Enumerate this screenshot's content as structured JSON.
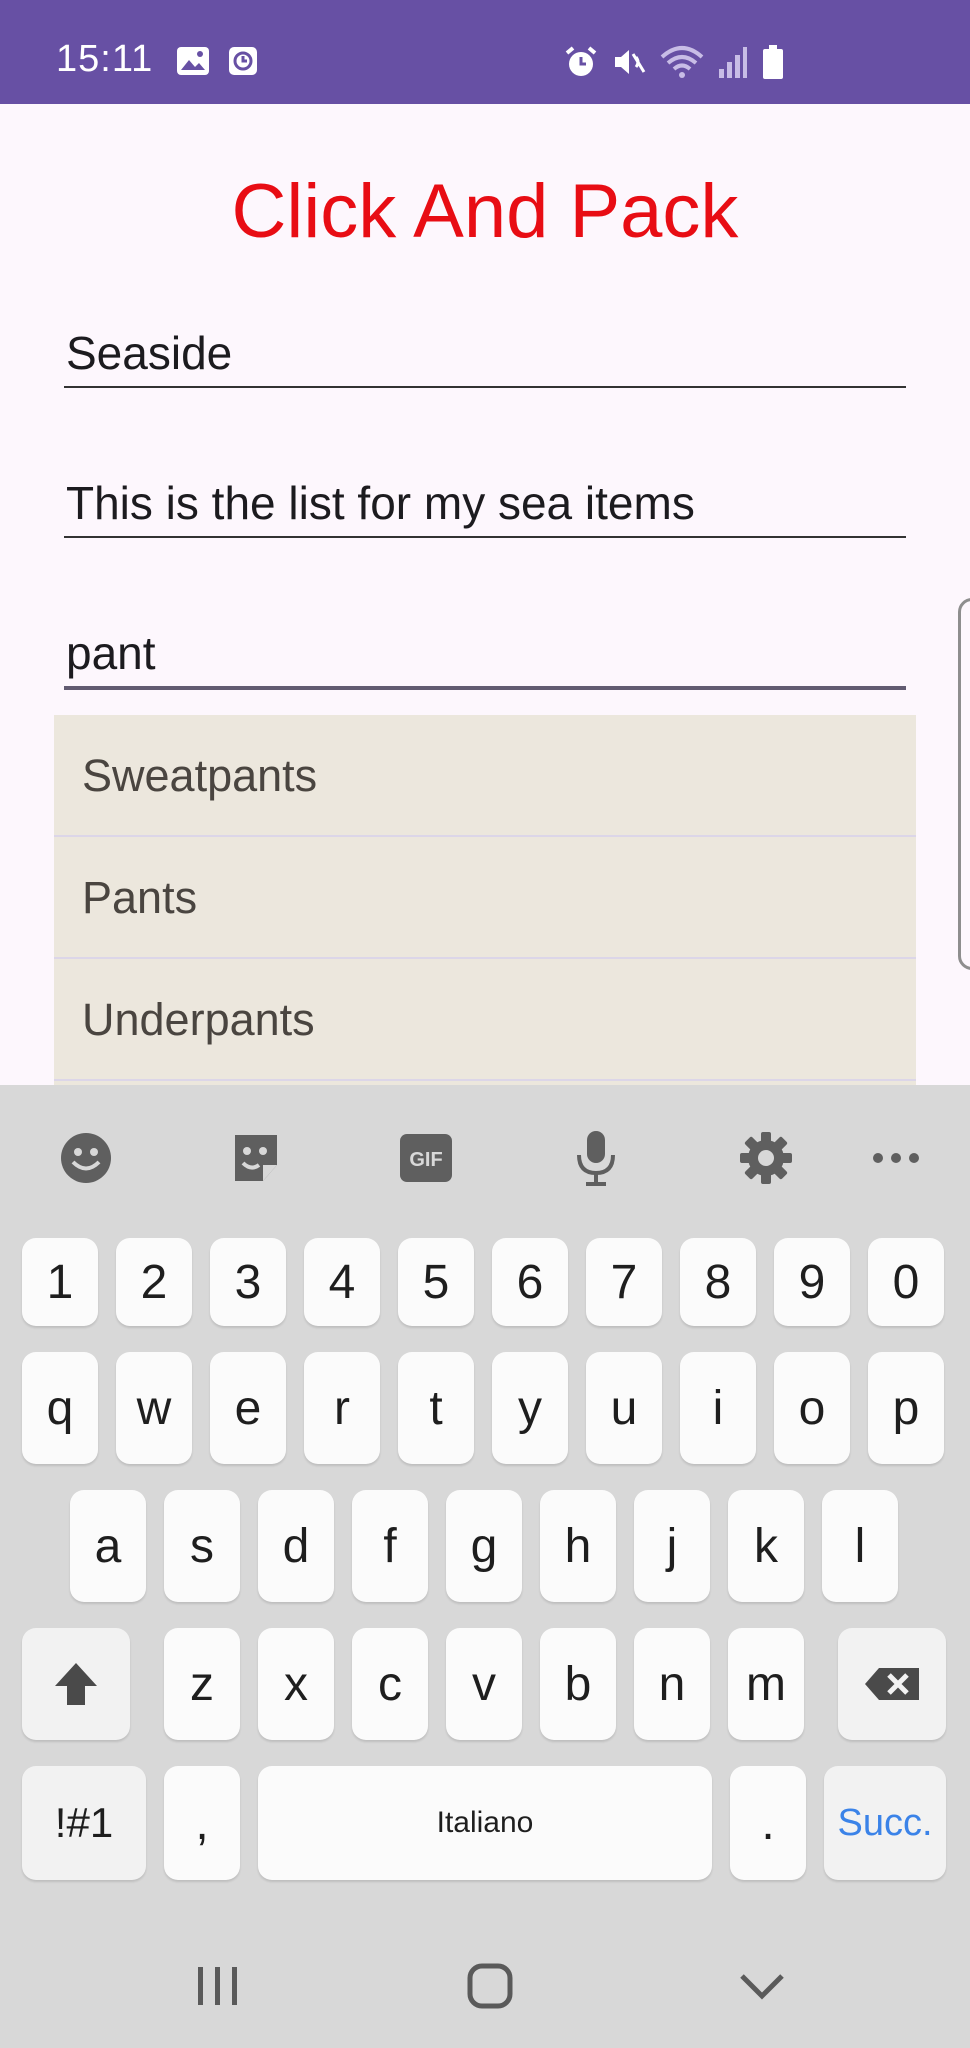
{
  "status_bar": {
    "time": "15:11",
    "left_icons": [
      "image-icon",
      "clock-app-icon"
    ],
    "right_icons": [
      "alarm-icon",
      "mute-icon",
      "wifi-icon",
      "signal-icon",
      "battery-icon"
    ],
    "background": "#6750a4"
  },
  "app": {
    "title": "Click And Pack",
    "title_color": "#e80d14",
    "list_name": "Seaside",
    "description": "This is the list for my sea items",
    "item_query": "pant"
  },
  "suggestions": [
    "Sweatpants",
    "Pants",
    "Underpants"
  ],
  "keyboard": {
    "toolbar": [
      "emoji-icon",
      "sticker-icon",
      "gif-icon",
      "microphone-icon",
      "settings-icon",
      "more-icon"
    ],
    "gif_label": "GIF",
    "row_numbers": [
      "1",
      "2",
      "3",
      "4",
      "5",
      "6",
      "7",
      "8",
      "9",
      "0"
    ],
    "row_1": [
      "q",
      "w",
      "e",
      "r",
      "t",
      "y",
      "u",
      "i",
      "o",
      "p"
    ],
    "row_2": [
      "a",
      "s",
      "d",
      "f",
      "g",
      "h",
      "j",
      "k",
      "l"
    ],
    "row_3": [
      "z",
      "x",
      "c",
      "v",
      "b",
      "n",
      "m"
    ],
    "symbols_label": "!#1",
    "comma": ",",
    "space_label": "Italiano",
    "period": ".",
    "enter_label": "Succ.",
    "accent_color": "#3b83e8"
  },
  "nav_bar": [
    "recent-apps-icon",
    "home-icon",
    "hide-keyboard-icon"
  ]
}
